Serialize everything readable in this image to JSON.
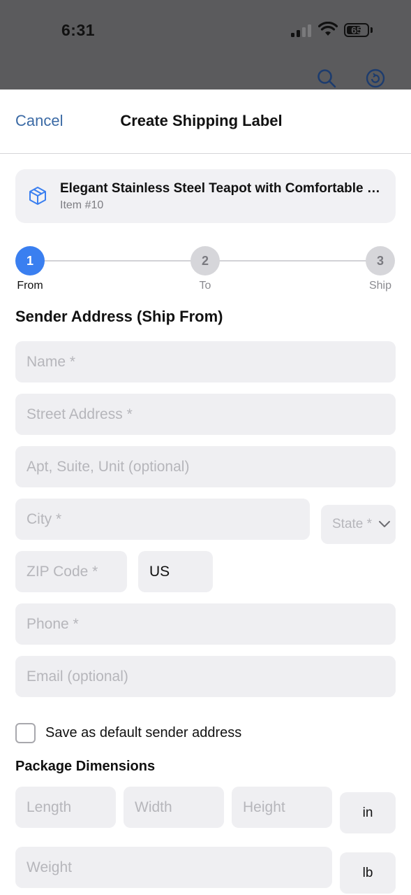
{
  "status_bar": {
    "time": "6:31",
    "battery": "65"
  },
  "header": {
    "cancel_label": "Cancel",
    "title": "Create Shipping Label"
  },
  "item": {
    "title": "Elegant Stainless Steel Teapot with Comfortable Handle",
    "subtitle": "Item #10",
    "icon": "package-icon"
  },
  "stepper": {
    "current_step": 1,
    "steps": [
      {
        "number": "1",
        "label": "From"
      },
      {
        "number": "2",
        "label": "To"
      },
      {
        "number": "3",
        "label": "Ship"
      }
    ]
  },
  "sender": {
    "title": "Sender Address (Ship From)",
    "name_placeholder": "Name *",
    "street_placeholder": "Street Address *",
    "apt_placeholder": "Apt, Suite, Unit (optional)",
    "city_placeholder": "City *",
    "state_placeholder": "State *",
    "zip_placeholder": "ZIP Code *",
    "country_value": "US",
    "phone_placeholder": "Phone *",
    "email_placeholder": "Email (optional)",
    "save_default_label": "Save as default sender address"
  },
  "package": {
    "title": "Package Dimensions",
    "length_placeholder": "Length",
    "width_placeholder": "Width",
    "height_placeholder": "Height",
    "dimension_unit": "in",
    "weight_placeholder": "Weight",
    "weight_unit": "lb"
  },
  "colors": {
    "accent": "#3a7ff0",
    "link": "#3b6aa5",
    "field_bg": "#efeff2"
  }
}
